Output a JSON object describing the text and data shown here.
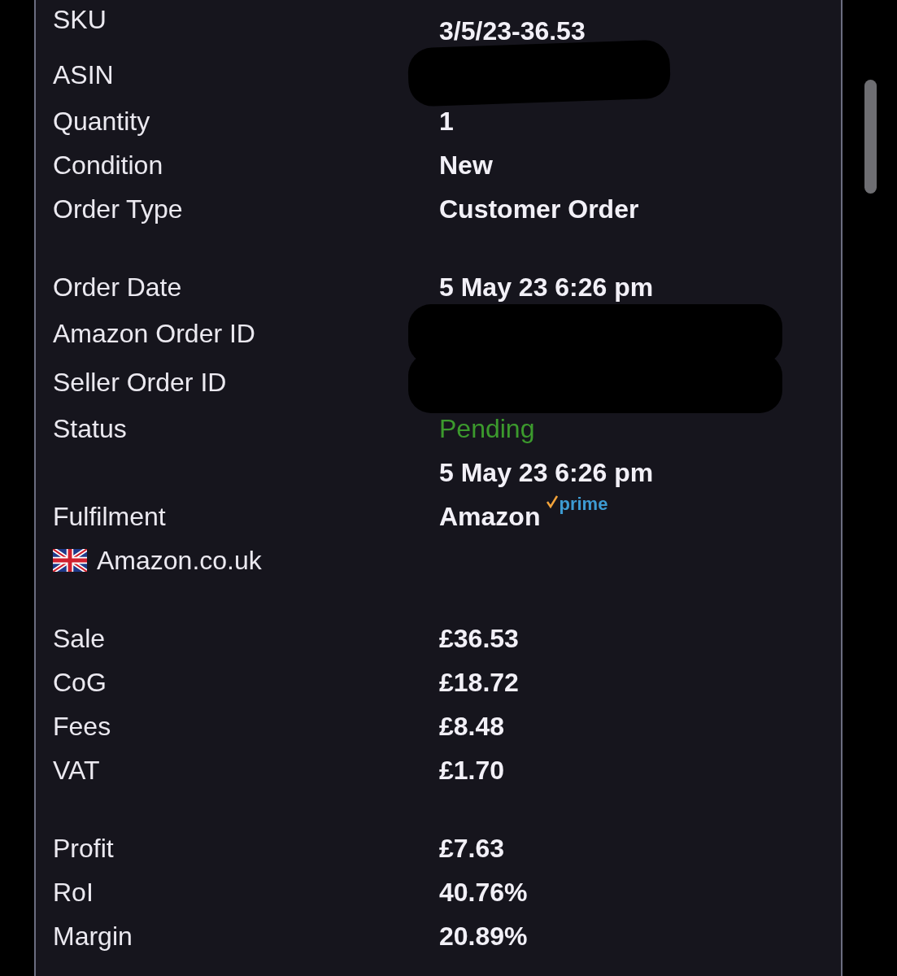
{
  "sections": [
    {
      "rows": [
        {
          "kind": "split",
          "label": "SKU",
          "value": "3/5/23-36.53"
        },
        {
          "kind": "redacted",
          "label": "ASIN"
        },
        {
          "kind": "text",
          "label": "Quantity",
          "value": "1"
        },
        {
          "kind": "text",
          "label": "Condition",
          "value": "New"
        },
        {
          "kind": "text",
          "label": "Order Type",
          "value": "Customer Order"
        }
      ]
    },
    {
      "rows": [
        {
          "kind": "text",
          "label": "Order Date",
          "value": "5 May 23 6:26 pm"
        },
        {
          "kind": "redacted",
          "label": "Amazon Order ID"
        },
        {
          "kind": "redacted",
          "label": "Seller Order ID"
        },
        {
          "kind": "status",
          "label": "Status",
          "value": "Pending"
        },
        {
          "kind": "text",
          "value": "5 May 23 6:26 pm"
        },
        {
          "kind": "fulfilment",
          "label": "Fulfilment",
          "value": "Amazon",
          "badge": "prime"
        },
        {
          "kind": "marketplace",
          "label": "Amazon.co.uk"
        }
      ]
    },
    {
      "rows": [
        {
          "kind": "text",
          "label": "Sale",
          "value": "£36.53"
        },
        {
          "kind": "text",
          "label": "CoG",
          "value": "£18.72"
        },
        {
          "kind": "text",
          "label": "Fees",
          "value": "£8.48"
        },
        {
          "kind": "text",
          "label": "VAT",
          "value": "£1.70"
        }
      ]
    },
    {
      "rows": [
        {
          "kind": "text",
          "label": "Profit",
          "value": "£7.63"
        },
        {
          "kind": "text",
          "label": "RoI",
          "value": "40.76%"
        },
        {
          "kind": "text",
          "label": "Margin",
          "value": "20.89%"
        }
      ]
    }
  ]
}
